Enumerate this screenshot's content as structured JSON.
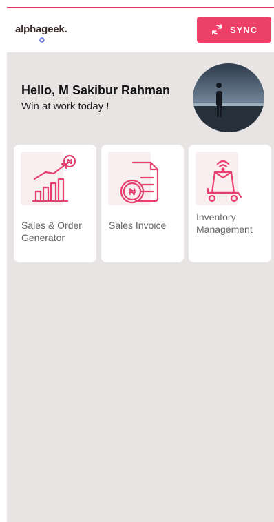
{
  "header": {
    "logo_text": "alphageek.",
    "sync_label": "SYNC"
  },
  "greeting": {
    "title": "Hello, M Sakibur Rahman",
    "subtitle": "Win at work today !"
  },
  "cards": [
    {
      "label": "Sales & Order Generator",
      "icon": "sales-growth-icon"
    },
    {
      "label": "Sales Invoice",
      "icon": "invoice-icon"
    },
    {
      "label": "Inventory Management",
      "icon": "inventory-icon"
    }
  ],
  "colors": {
    "accent": "#ec4069",
    "background": "#e8e4e4",
    "card": "#ffffff"
  }
}
